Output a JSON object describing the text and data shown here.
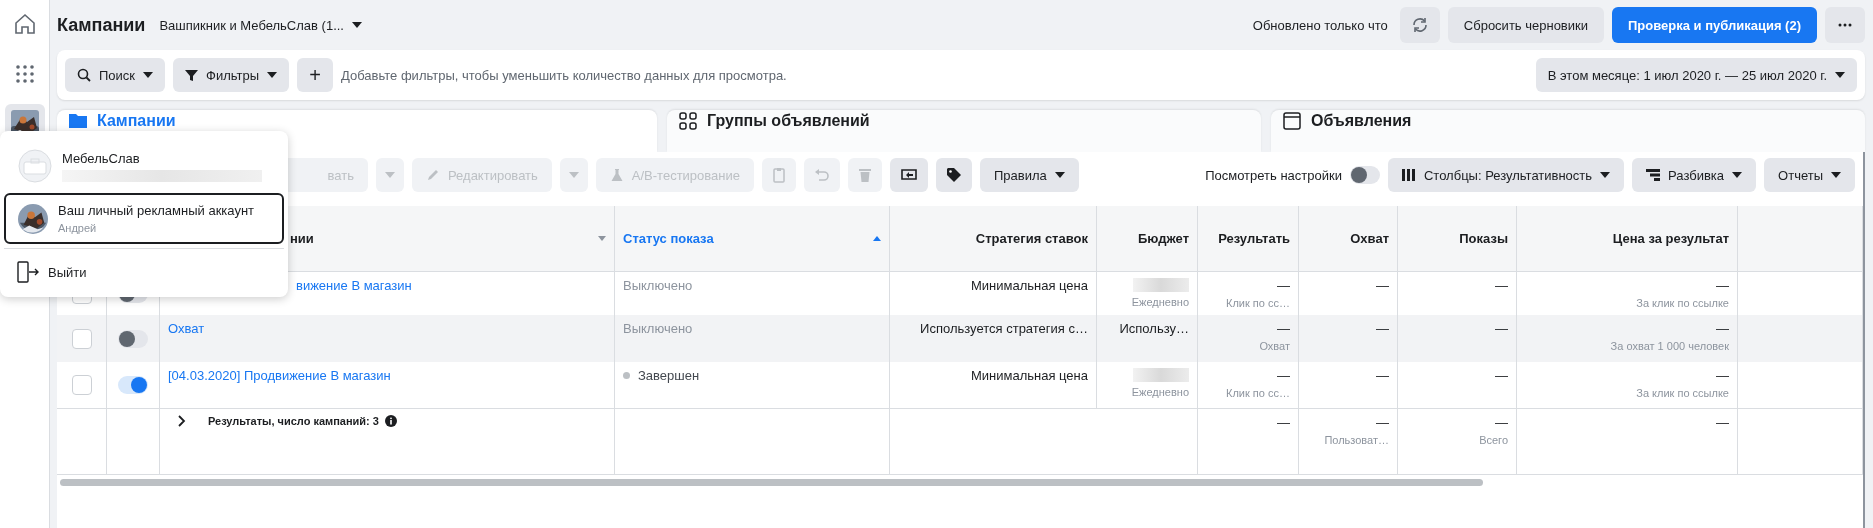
{
  "header": {
    "title": "Кампании",
    "account": "Вашпикник и МебельСлав (1...",
    "updated": "Обновлено только что",
    "reset_button": "Сбросить черновики",
    "publish_button": "Проверка и публикация (2)"
  },
  "filter_bar": {
    "search": "Поиск",
    "filters": "Фильтры",
    "add": "+",
    "hint": "Добавьте фильтры, чтобы уменьшить количество данных для просмотра.",
    "date_range": "В этом месяце: 1 июл 2020 г. — 25 июл 2020 г."
  },
  "tabs": [
    {
      "label": "Кампании",
      "selected": true
    },
    {
      "label": "Группы объявлений",
      "selected": false
    },
    {
      "label": "Объявления",
      "selected": false
    }
  ],
  "toolbar": {
    "buttons": [
      {
        "kind": "create",
        "label": "вать",
        "disabled": true
      },
      {
        "kind": "edit",
        "label": "Редактировать",
        "disabled": true
      },
      {
        "kind": "abtest",
        "label": "A/B-тестирование",
        "disabled": true
      },
      {
        "kind": "duplicate",
        "disabled": true
      },
      {
        "kind": "undo",
        "disabled": true
      },
      {
        "kind": "delete",
        "disabled": true
      },
      {
        "kind": "export",
        "disabled": false
      },
      {
        "kind": "tag",
        "disabled": false
      },
      {
        "kind": "rules",
        "label": "Правила",
        "disabled": false
      }
    ],
    "view_settings": {
      "label": "Посмотреть настройки",
      "on": false
    },
    "columns": "Столбцы: Результативность",
    "breakdown": "Разбивка",
    "reports": "Отчеты"
  },
  "table": {
    "columns": [
      {
        "label": "нии",
        "sorted": false
      },
      {
        "label": "Статус показа",
        "sorted": true
      },
      {
        "label": "Стратегия ставок"
      },
      {
        "label": "Бюджет"
      },
      {
        "label": "Результать"
      },
      {
        "label": "Охват"
      },
      {
        "label": "Показы"
      },
      {
        "label": "Цена за результат"
      }
    ],
    "rows": [
      {
        "name": "вижение В магазин",
        "checked": false,
        "active": false,
        "highlighted": false,
        "status": "Выключено",
        "status_dot": false,
        "status_dimmed": true,
        "strategy": "Минимальная цена",
        "budget_redacted": true,
        "budget_note": "Ежедневно",
        "results": "—",
        "results_note": "Клик по сс…",
        "reach": "—",
        "impressions": "—",
        "cost": "—",
        "cost_note": "За клик по ссылке"
      },
      {
        "name": "Охват",
        "checked": false,
        "active": false,
        "highlighted": true,
        "status": "Выключено",
        "status_dot": false,
        "status_dimmed": true,
        "strategy": "Используется стратегия с…",
        "budget": "Использу…",
        "budget_redacted": false,
        "results": "—",
        "results_note": "Охват",
        "reach": "—",
        "impressions": "—",
        "cost": "—",
        "cost_note": "За охват 1 000 человек"
      },
      {
        "name": "[04.03.2020] Продвижение В магазин",
        "checked": false,
        "active": true,
        "highlighted": false,
        "status": "Завершен",
        "status_dot": true,
        "status_dimmed": false,
        "strategy": "Минимальная цена",
        "budget_redacted": true,
        "budget_note": "Ежедневно",
        "results": "—",
        "results_note": "Клик по сс…",
        "reach": "—",
        "impressions": "—",
        "cost": "—",
        "cost_note": "За клик по ссылке"
      }
    ],
    "summary": {
      "label": "Результаты, число кампаний: 3",
      "results": "—",
      "reach": "—",
      "reach_note": "Пользоват…",
      "impressions": "—",
      "impressions_note": "Всего",
      "cost": "—"
    }
  },
  "account_menu": {
    "items": [
      {
        "kind": "page",
        "name": "МебельСлав",
        "subtitle_redacted": true,
        "selected": false
      },
      {
        "kind": "personal",
        "name": "Ваш личный рекламный аккаунт",
        "subtitle": "Андрей",
        "selected": true
      }
    ],
    "logout": "Выйти"
  }
}
